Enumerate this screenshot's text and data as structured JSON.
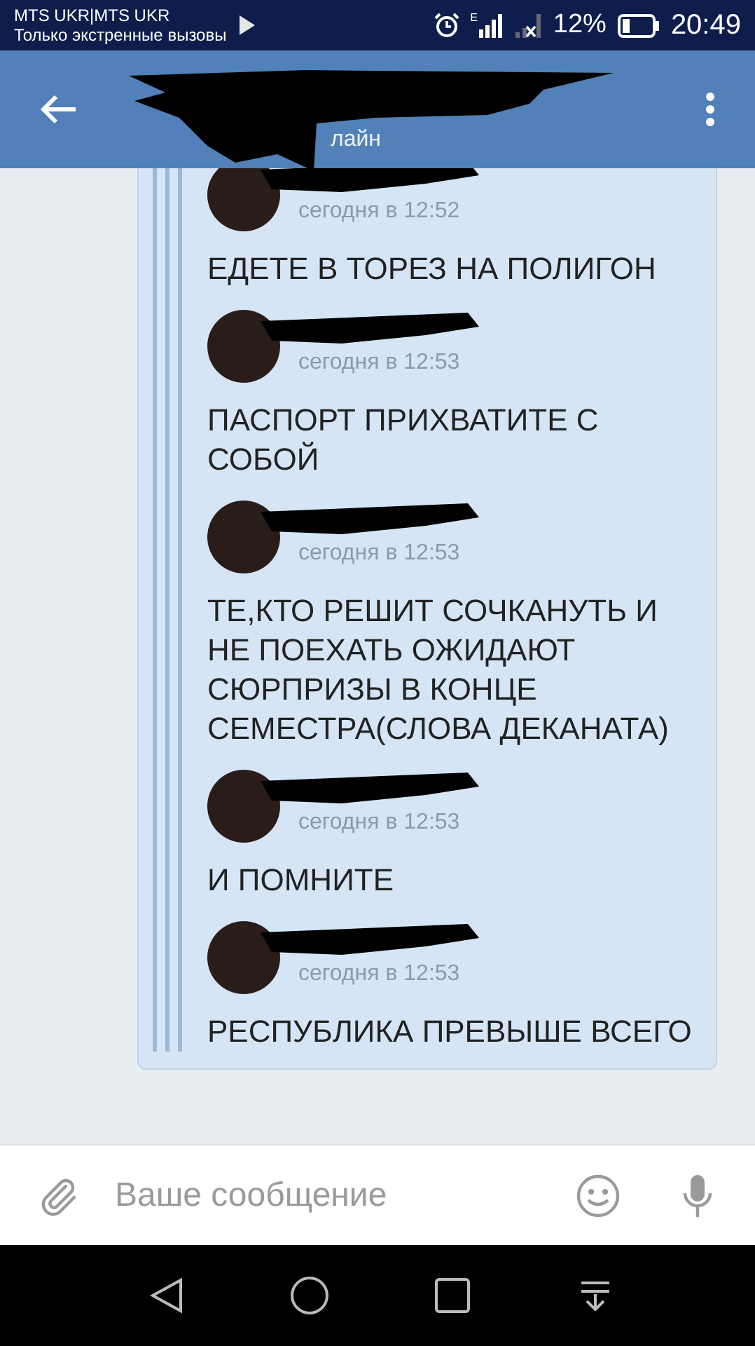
{
  "status_bar": {
    "carrier": "MTS UKR|MTS UKR",
    "notice": "Только экстренные вызовы",
    "network_label": "E",
    "battery": "12%",
    "time": "20:49"
  },
  "header": {
    "status": "лайн"
  },
  "messages": [
    {
      "time": "сегодня в 12:52",
      "text": "ЕДЕТЕ В ТОРЕЗ НА ПОЛИГОН"
    },
    {
      "time": "сегодня в 12:53",
      "text": "ПАСПОРТ ПРИХВАТИТЕ С СОБОЙ"
    },
    {
      "time": "сегодня в 12:53",
      "text": "ТЕ,КТО РЕШИТ СОЧКАНУТЬ И НЕ ПОЕХАТЬ ОЖИДАЮТ СЮРПРИЗЫ В КОНЦЕ СЕМЕСТРА(СЛОВА ДЕКАНАТА)"
    },
    {
      "time": "сегодня в 12:53",
      "text": "И ПОМНИТЕ"
    },
    {
      "time": "сегодня в 12:53",
      "text": "РЕСПУБЛИКА ПРЕВЫШЕ ВСЕГО"
    }
  ],
  "composer": {
    "placeholder": "Ваше сообщение"
  }
}
